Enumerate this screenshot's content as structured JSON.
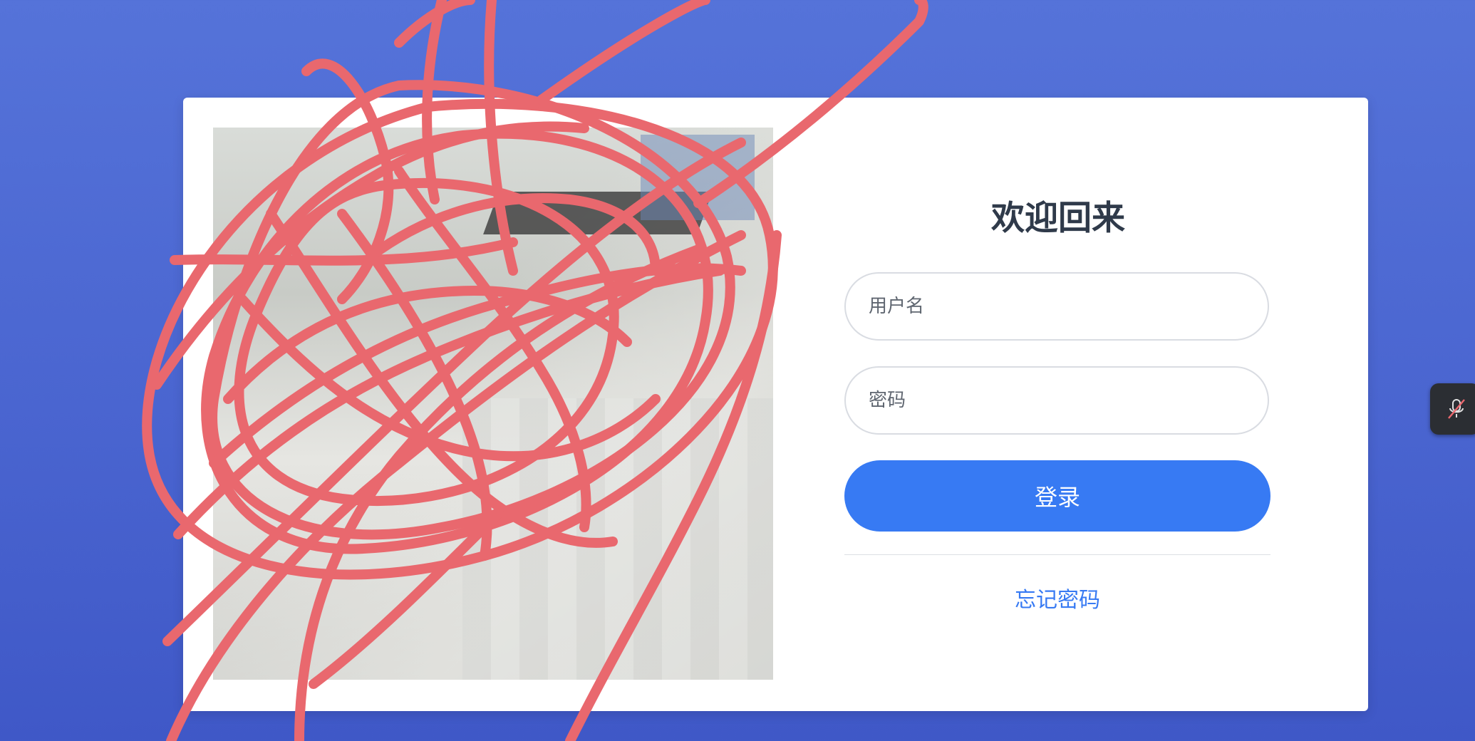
{
  "login": {
    "title": "欢迎回来",
    "username_placeholder": "用户名",
    "password_placeholder": "密码",
    "login_label": "登录",
    "forgot_label": "忘记密码"
  },
  "colors": {
    "background": "#4f6ad5",
    "primary": "#377af3",
    "scribble": "#e9686e",
    "card": "#ffffff"
  },
  "icons": {
    "mic": "microphone-muted-icon"
  }
}
